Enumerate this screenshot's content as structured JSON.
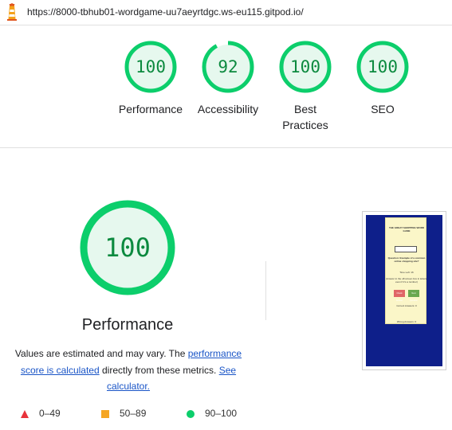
{
  "browser": {
    "url": "https://8000-tbhub01-wordgame-uu7aeyrtdgc.ws-eu115.gitpod.io/",
    "logo_icon": "lighthouse-icon"
  },
  "summary": {
    "scores": [
      {
        "value": "100",
        "label": "Performance",
        "score": 100
      },
      {
        "value": "92",
        "label": "Accessibility",
        "score": 92
      },
      {
        "value": "100",
        "label": "Best Practices",
        "score": 100
      },
      {
        "value": "100",
        "label": "SEO",
        "score": 100
      }
    ]
  },
  "performance": {
    "score": "100",
    "title": "Performance",
    "note_prefix": "Values are estimated and may vary. The ",
    "note_link1": "performance score is calculated",
    "note_middle": " directly from these metrics. ",
    "note_link2": "See calculator."
  },
  "screenshot": {
    "title": "THE GREAT SHOPPING WORD GAME",
    "question": "Question: Example of a common online shopping site?",
    "time_left": "Time Left: 16",
    "hint": "(Answer in the off-screen box in letters, even if it's a number)",
    "btn_left": "Check Answer",
    "btn_right": "Next Question",
    "correct": "Correct Answers: 0",
    "wrong": "Wrong Answers: 0"
  },
  "legend": [
    {
      "range": "0–49",
      "color": "#e8333b",
      "shape": "triangle"
    },
    {
      "range": "50–89",
      "color": "#f5a623",
      "shape": "square"
    },
    {
      "range": "90–100",
      "color": "#0cce6b",
      "shape": "circle"
    }
  ],
  "colors": {
    "pass": "#0cce6b",
    "pass_text": "#0c8a3f",
    "pass_fill": "#e6f8ee",
    "link": "#1a55c7"
  }
}
